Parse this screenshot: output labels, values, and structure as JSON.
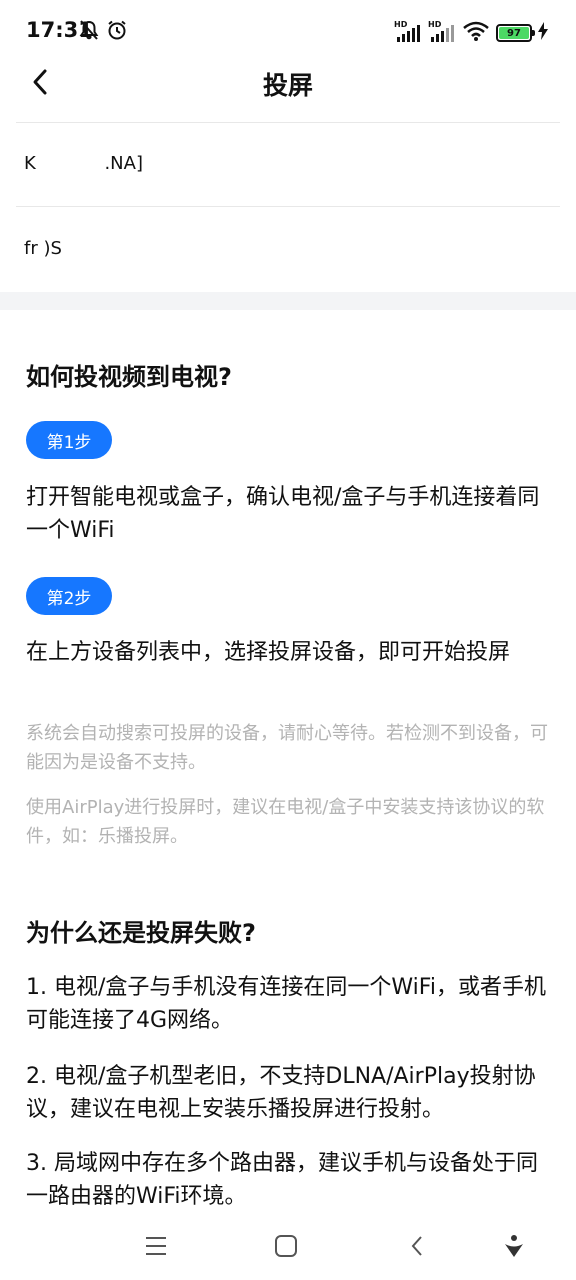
{
  "status_bar": {
    "time": "17:31",
    "left_icons": [
      "mute-bell-icon",
      "alarm-icon"
    ],
    "right_icons": [
      "signal-hd-1-icon",
      "signal-hd-2-icon",
      "wifi-icon",
      "battery-icon",
      "charging-icon"
    ],
    "hd_label_1": "HD",
    "hd_label_2": "HD",
    "battery_level": "97",
    "battery_color": "#4cd964"
  },
  "header": {
    "title": "投屏",
    "back_icon": "chevron-left-icon"
  },
  "devices": [
    {
      "name": "K            .NA]"
    },
    {
      "name": "fr )S"
    }
  ],
  "guide": {
    "title": "如何投视频到电视?",
    "step1": {
      "badge": "第1步",
      "text": "打开智能电视或盒子，确认电视/盒子与手机连接着同一个WiFi"
    },
    "step2": {
      "badge": "第2步",
      "text": "在上方设备列表中，选择投屏设备，即可开始投屏"
    },
    "note1": "系统会自动搜索可投屏的设备，请耐心等待。若检测不到设备，可能因为是设备不支持。",
    "note2": "使用AirPlay进行投屏时，建议在电视/盒子中安装支持该协议的软件，如：乐播投屏。"
  },
  "faq": {
    "title": "为什么还是投屏失败?",
    "item1": "1. 电视/盒子与手机没有连接在同一个WiFi，或者手机可能连接了4G网络。",
    "item2": "2. 电视/盒子机型老旧，不支持DLNA/AirPlay投射协议，建议在电视上安装乐播投屏进行投射。",
    "item3": "3. 局域网中存在多个路由器，建议手机与设备处于同一路由器的WiFi环境。"
  },
  "nav_bar": {
    "icons": [
      "menu-icon",
      "home-icon",
      "back-icon",
      "assistant-icon"
    ]
  },
  "colors": {
    "accent": "#1677ff",
    "note_gray": "#b3b3b3",
    "band_gray": "#f3f4f6"
  }
}
